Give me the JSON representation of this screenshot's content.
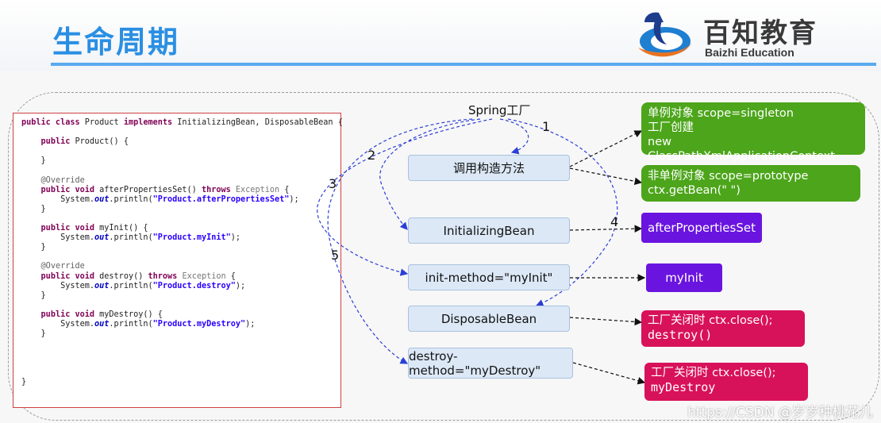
{
  "slide": {
    "title": "生命周期",
    "logo_cn": "百知教育",
    "logo_en": "Baizhi Education",
    "watermark": "https://CSDN @岁岁种桃花儿"
  },
  "code": {
    "lines": [
      "public class Product implements InitializingBean, DisposableBean {",
      "",
      "    public Product() {",
      "",
      "    }",
      "",
      "    @Override",
      "    public void afterPropertiesSet() throws Exception {",
      "        System.out.println(\"Product.afterPropertiesSet\");",
      "    }",
      "",
      "    public void myInit() {",
      "        System.out.println(\"Product.myInit\");",
      "    }",
      "",
      "    @Override",
      "    public void destroy() throws Exception {",
      "        System.out.println(\"Product.destroy\");",
      "    }",
      "",
      "    public void myDestroy() {",
      "        System.out.println(\"Product.myDestroy\");",
      "    }",
      "",
      "",
      "",
      "",
      "}"
    ]
  },
  "diagram": {
    "spring_label": "Spring工厂",
    "steps": [
      "1",
      "2",
      "3",
      "4",
      "5"
    ],
    "nodes": {
      "constructor": "调用构造方法",
      "initializing_bean": "InitializingBean",
      "init_method": "init-method=\"myInit\"",
      "disposable_bean": "DisposableBean",
      "destroy_method": "destroy-method=\"myDestroy\""
    },
    "notes": {
      "singleton_1": "单例对象 scope=singleton",
      "singleton_2": "工厂创建",
      "singleton_3": "new ClassPathXmlApplicationContext",
      "prototype_1": "非单例对象 scope=prototype",
      "prototype_2": "ctx.getBean(\" \")",
      "after_properties_set": "afterPropertiesSet",
      "my_init": "myInit",
      "destroy_1": "工厂关闭时 ctx.close();",
      "destroy_2": "destroy()",
      "my_destroy_1": "工厂关闭时 ctx.close();",
      "my_destroy_2": "myDestroy"
    },
    "colors": {
      "green": "#4ca51a",
      "purple": "#6a14e0",
      "magenta": "#d8125a",
      "node_fill": "#dce8f6",
      "arrow_blue": "#2b3fd6",
      "title_blue": "#2a8fe3"
    }
  }
}
